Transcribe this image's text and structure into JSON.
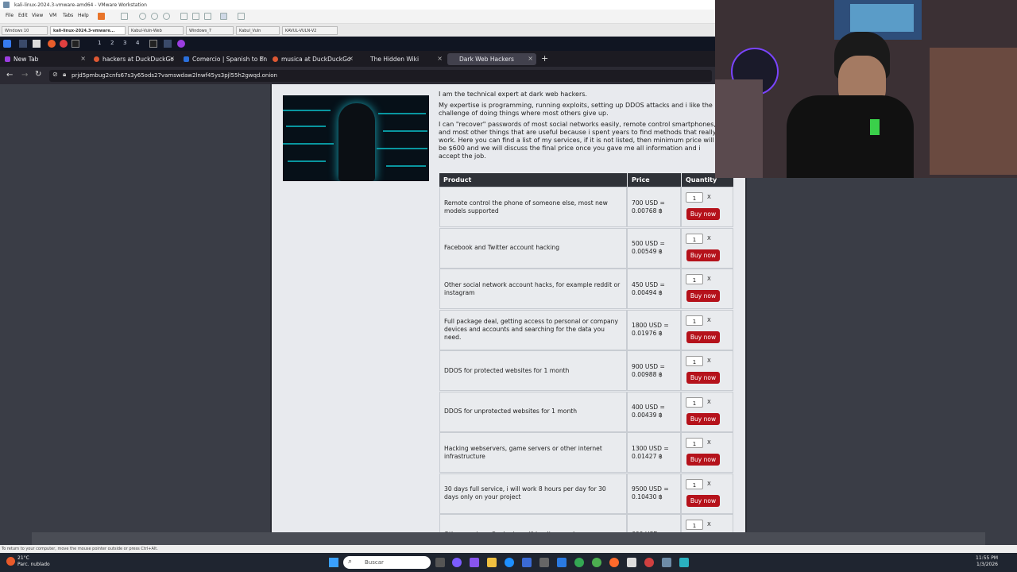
{
  "vmware": {
    "title": "kali-linux-2024.3-vmware-amd64 - VMware Workstation",
    "menu": [
      "File",
      "Edit",
      "View",
      "VM",
      "Tabs",
      "Help"
    ],
    "vm_tabs": [
      "Windows 10",
      "kali-linux-2024.3-vmware...",
      "Kabul-Vuln-Web",
      "Windows_7",
      "Kabul_Vuln",
      "KAVUL-VULN-V2"
    ],
    "status_hint": "To return to your computer, move the mouse pointer outside or press Ctrl+Alt."
  },
  "kali_panel": {
    "workspaces": [
      "1",
      "2",
      "3",
      "4"
    ]
  },
  "browser": {
    "tabs": [
      "New Tab",
      "hackers at DuckDuckGo",
      "Comercio | Spanish to En",
      "musica at DuckDuckGo",
      "The Hidden Wiki",
      "Dark Web Hackers"
    ],
    "url": "prjd5pmbug2cnfs67s3y65ods27vamswdaw2lnwf45ys3pjl55h2gwqd.onion"
  },
  "page": {
    "intro_cut": "I am the technical expert at dark web hackers.",
    "intro_p1": "My expertise is programming, running exploits, setting up DDOS attacks and i like the challenge of doing things where most others give up.",
    "intro_p2": "I can \"recover\" passwords of most social networks easily, remote control smartphones, and most other things that are useful because i spent years to find methods that really work. Here you can find a list of my services, if it is not listed, then minimum price will be $600 and we will discuss the final price once you gave me all information and i accept the job.",
    "headers": {
      "product": "Product",
      "price": "Price",
      "quantity": "Quantity"
    },
    "rows": [
      {
        "product": "Remote control the phone of someone else, most new models supported",
        "price": "700 USD = 0.00768 ฿",
        "qty": "1"
      },
      {
        "product": "Facebook and Twitter account hacking",
        "price": "500 USD = 0.00549 ฿",
        "qty": "1"
      },
      {
        "product": "Other social network account hacks, for example reddit or instagram",
        "price": "450 USD = 0.00494 ฿",
        "qty": "1"
      },
      {
        "product": "Full package deal, getting access to personal or company devices and accounts and searching for the data you need.",
        "price": "1800 USD = 0.01976 ฿",
        "qty": "1"
      },
      {
        "product": "DDOS for protected websites for 1 month",
        "price": "900 USD = 0.00988 ฿",
        "qty": "1"
      },
      {
        "product": "DDOS for unprotected websites for 1 month",
        "price": "400 USD = 0.00439 ฿",
        "qty": "1"
      },
      {
        "product": "Hacking webservers, game servers or other internet infrastructure",
        "price": "1300 USD = 0.01427 ฿",
        "qty": "1"
      },
      {
        "product": "30 days full service, i will work 8 hours per day for 30 days only on your project",
        "price": "9500 USD = 0.10430 ฿",
        "qty": "1"
      },
      {
        "product": "Other services, final price will be discussed",
        "price": "600 USD =",
        "qty": "1"
      }
    ],
    "qty_x": "X",
    "buy_label": "Buy now"
  },
  "taskbar": {
    "weather_temp": "21°C",
    "weather_desc": "Parc. nublado",
    "search_placeholder": "Buscar",
    "time": "11:55 PM",
    "date": "1/3/2026"
  },
  "colors": {
    "buy_button": "#b5121b",
    "table_header": "#2f3238",
    "page_bg": "#3a3d46"
  }
}
